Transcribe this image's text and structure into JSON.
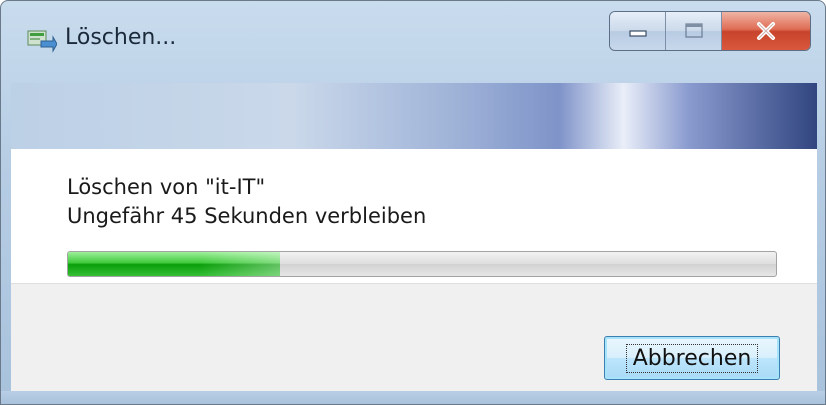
{
  "window": {
    "title": "Löschen...",
    "app_icon": "delete-progress-icon",
    "controls": {
      "minimize_icon": "minimize-icon",
      "maximize_icon": "maximize-icon",
      "close_icon": "close-icon"
    }
  },
  "content": {
    "status_line": "Löschen von \"it-IT\"",
    "time_remaining": "Ungefähr 45 Sekunden verbleiben",
    "progress_fraction": 0.3
  },
  "footer": {
    "cancel_label": "Abbrechen"
  },
  "colors": {
    "progress": "#2fbf2f",
    "close_button": "#c8432b",
    "focus_button_border": "#3c7fb1"
  }
}
